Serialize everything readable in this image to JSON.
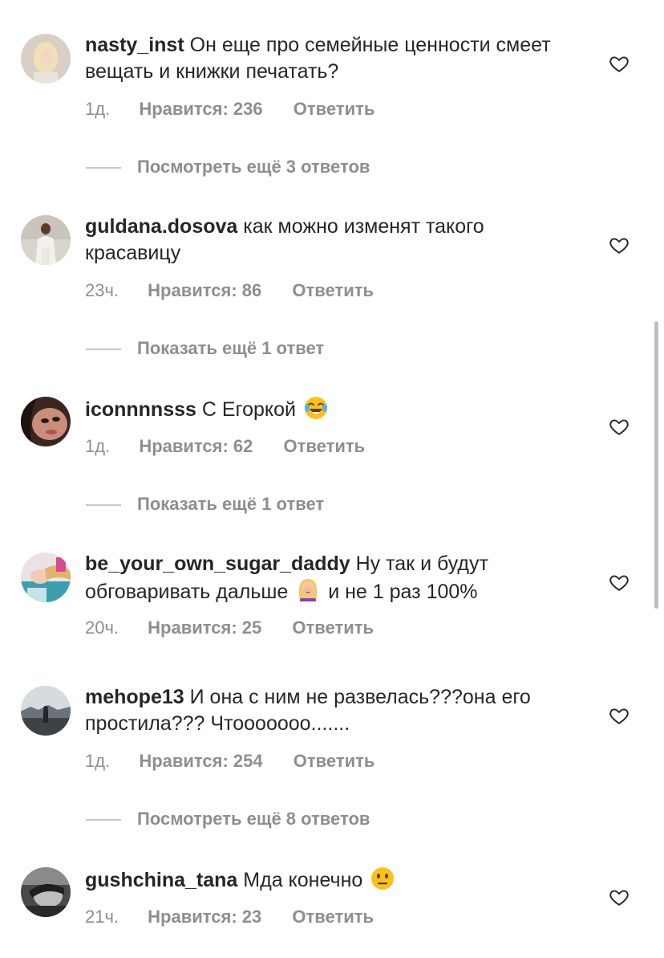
{
  "comments": [
    {
      "username": "nasty_inst",
      "text_before_emoji": "Он еще про семейные ценности смеет вещать и книжки печатать?",
      "text_after_emoji": "",
      "emoji": "",
      "time": "1д.",
      "likes": "Нравится: 236",
      "reply": "Ответить",
      "view_replies": "Посмотреть ещё 3 ответов",
      "avatar_icon": "blonde-woman-avatar"
    },
    {
      "username": "guldana.dosova",
      "text_before_emoji": "как можно изменят такого красавицу",
      "text_after_emoji": "",
      "emoji": "",
      "time": "23ч.",
      "likes": "Нравится: 86",
      "reply": "Ответить",
      "view_replies": "Показать ещё 1 ответ",
      "avatar_icon": "woman-white-suit-avatar"
    },
    {
      "username": "iconnnnsss",
      "text_before_emoji": "С Егоркой",
      "text_after_emoji": "",
      "emoji": "face-with-tears-of-joy",
      "time": "1д.",
      "likes": "Нравится: 62",
      "reply": "Ответить",
      "view_replies": "Показать ещё 1 ответ",
      "avatar_icon": "woman-closeup-avatar"
    },
    {
      "username": "be_your_own_sugar_daddy",
      "text_before_emoji": "Ну так и будут обговаривать дальше",
      "text_after_emoji": "и не 1 раз 100%",
      "emoji": "woman-facepalming",
      "time": "20ч.",
      "likes": "Нравится: 25",
      "reply": "Ответить",
      "view_replies": "",
      "avatar_icon": "woman-lying-avatar"
    },
    {
      "username": "mehope13",
      "text_before_emoji": "И она с ним не развелась???она его простила??? Чтооооооо.......",
      "text_after_emoji": "",
      "emoji": "",
      "time": "1д.",
      "likes": "Нравится: 254",
      "reply": "Ответить",
      "view_replies": "Посмотреть ещё 8 ответов",
      "avatar_icon": "landscape-avatar"
    },
    {
      "username": "gushchina_tana",
      "text_before_emoji": "Мда конечно",
      "text_after_emoji": "",
      "emoji": "neutral-face",
      "time": "21ч.",
      "likes": "Нравится: 23",
      "reply": "Ответить",
      "view_replies": "",
      "avatar_icon": "dark-portrait-avatar"
    }
  ],
  "colors": {
    "text": "#262626",
    "secondary": "#8e8e8e",
    "divider": "#c7c7c7"
  }
}
